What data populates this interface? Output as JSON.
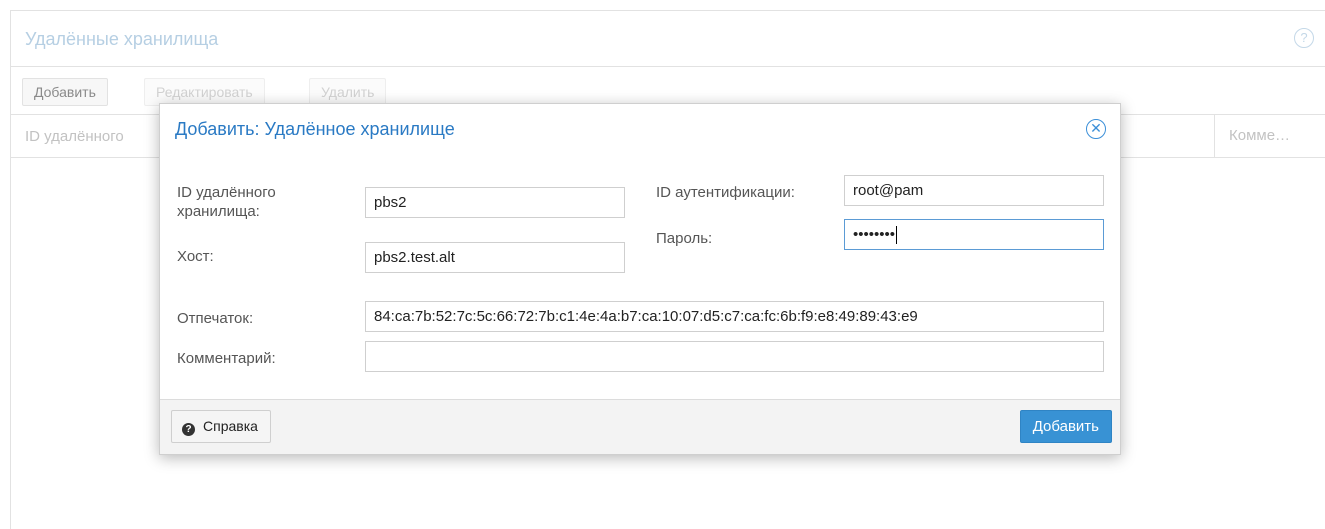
{
  "panel": {
    "title": "Удалённые хранилища",
    "help_icon": "question-circle-icon",
    "toolbar": {
      "add": "Добавить",
      "edit": "Редактировать",
      "delete": "Удалить"
    },
    "columns": {
      "id": "ID удалённого",
      "comment": "Комме…"
    }
  },
  "dialog": {
    "title": "Добавить: Удалённое хранилище",
    "close_icon": "close-circle-icon",
    "fields": {
      "remote_id_label": "ID удалённого хранилища:",
      "remote_id_value": "pbs2",
      "host_label": "Хост:",
      "host_value": "pbs2.test.alt",
      "auth_id_label": "ID аутентификации:",
      "auth_id_value": "root@pam",
      "password_label": "Пароль:",
      "password_value": "••••••••",
      "fingerprint_label": "Отпечаток:",
      "fingerprint_value": "84:ca:7b:52:7c:5c:66:72:7b:c1:4e:4a:b7:ca:10:07:d5:c7:ca:fc:6b:f9:e8:49:89:43:e9",
      "comment_label": "Комментарий:",
      "comment_value": ""
    },
    "footer": {
      "help": "Справка",
      "help_icon": "question-icon",
      "submit": "Добавить"
    }
  },
  "colors": {
    "accent": "#3892d4",
    "title_blue": "#2a7ac4",
    "faded_title": "#b6cfe3"
  }
}
